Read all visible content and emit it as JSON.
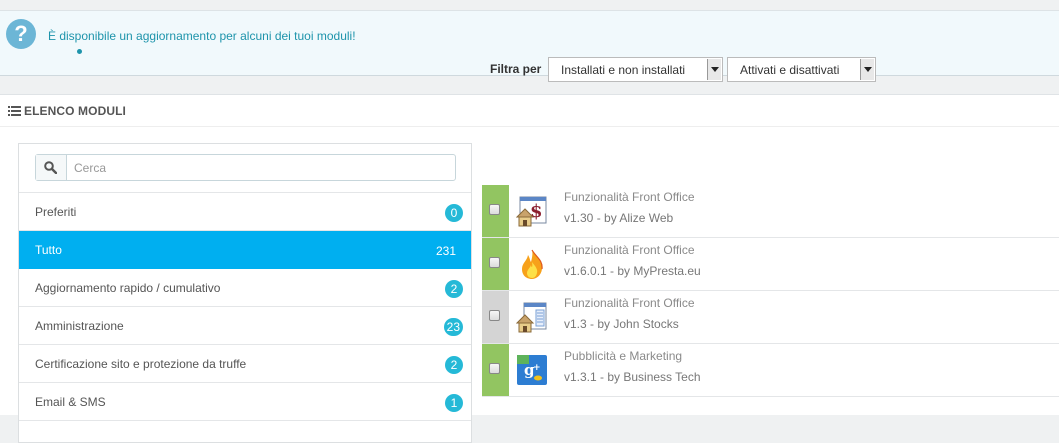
{
  "alert": {
    "message": "È disponibile un aggiornamento per alcuni dei tuoi moduli!",
    "icon": "question-icon"
  },
  "panel": {
    "title": "ELENCO MODULI",
    "icon": "list-icon"
  },
  "search": {
    "placeholder": "Cerca",
    "icon": "search-icon"
  },
  "categories": [
    {
      "label": "Preferiti",
      "count": "0"
    },
    {
      "label": "Tutto",
      "count": "231",
      "active": true
    },
    {
      "label": "Aggiornamento rapido / cumulativo",
      "count": "2"
    },
    {
      "label": "Amministrazione",
      "count": "23"
    },
    {
      "label": "Certificazione sito e protezione da truffe",
      "count": "2"
    },
    {
      "label": "Email & SMS",
      "count": "1"
    }
  ],
  "filter": {
    "label": "Filtra per",
    "install_status": "Installati e non installati",
    "active_status": "Attivati e disattivati"
  },
  "modules": [
    {
      "category": "Funzionalità Front Office",
      "version": "v1.30 - by Alize Web",
      "status_color": "#92c561",
      "icon": "house-price-icon"
    },
    {
      "category": "Funzionalità Front Office",
      "version": "v1.6.0.1 - by MyPresta.eu",
      "status_color": "#92c561",
      "icon": "flame-icon"
    },
    {
      "category": "Funzionalità Front Office",
      "version": "v1.3 - by John Stocks",
      "status_color": "#d4d4d4",
      "icon": "house-window-icon"
    },
    {
      "category": "Pubblicità e Marketing",
      "version": "v1.3.1 - by Business Tech",
      "status_color": "#92c561",
      "icon": "google-plus-icon"
    }
  ],
  "colors": {
    "accent": "#00aff0",
    "badge": "#25b9d7",
    "enabled": "#92c561",
    "disabled": "#d4d4d4"
  }
}
